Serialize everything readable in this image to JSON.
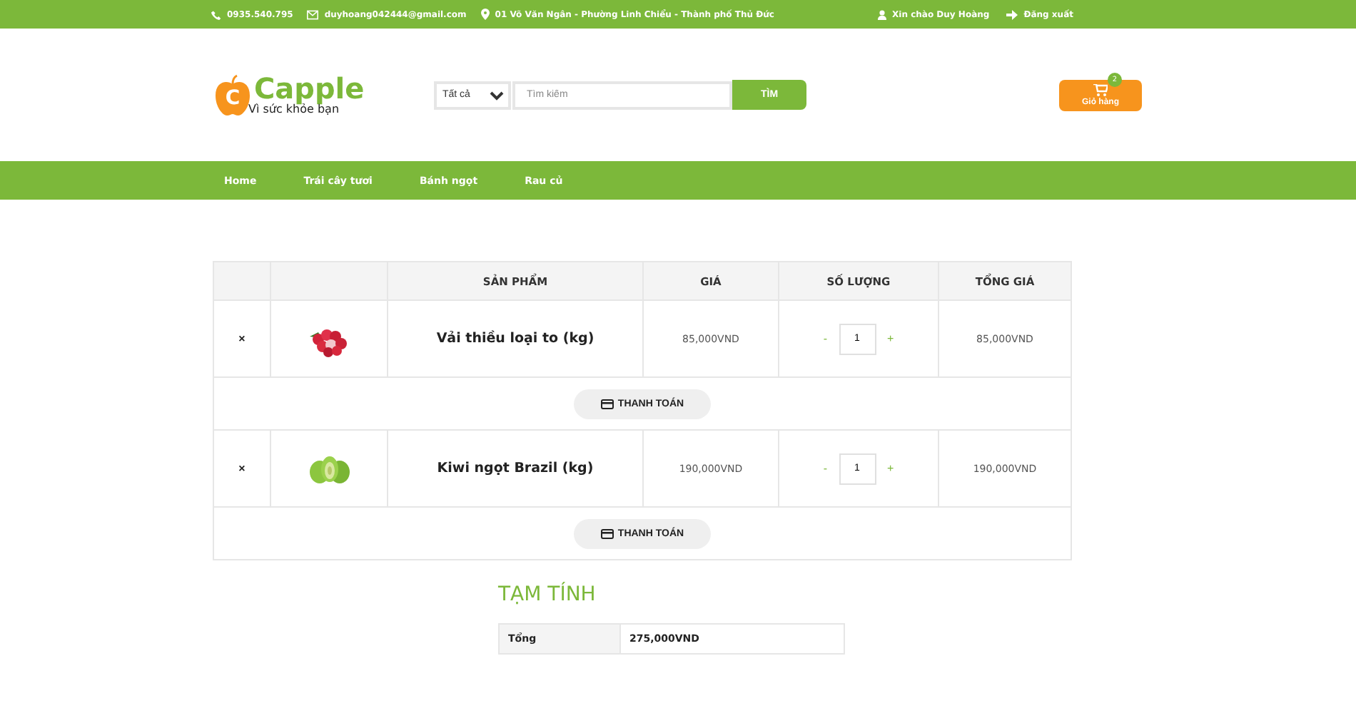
{
  "top_bar": {
    "phone": "0935.540.795",
    "email": "duyhoang042444@gmail.com",
    "address": "01 Võ Văn Ngân - Phường Linh Chiểu - Thành phố Thủ Đức",
    "greeting": "Xin chào Duy Hoàng",
    "logout": "Đăng xuất"
  },
  "header": {
    "logo_letter": "C",
    "logo_name": "Capple",
    "tagline": "Vì sức khỏe bạn",
    "category_select": "Tất cả",
    "search": {
      "placeholder": "Tìm kiếm"
    },
    "search_button": "TÌM",
    "cart": {
      "label": "Giỏ hàng",
      "count": "2"
    }
  },
  "nav": [
    {
      "label": "Home"
    },
    {
      "label": "Trái cây tươi"
    },
    {
      "label": "Bánh ngọt"
    },
    {
      "label": "Rau củ"
    }
  ],
  "cart_table": {
    "columns": [
      "SẢN PHẨM",
      "GIÁ",
      "SỐ LƯỢNG",
      "TỔNG GIÁ"
    ],
    "rows": [
      {
        "remove": "×",
        "name": "Vải thiều loại to (kg)",
        "price": "85,000VND",
        "minus": "-",
        "quantity": "1",
        "plus": "+",
        "total": "85,000VND",
        "checkout": "THANH TOÁN"
      },
      {
        "remove": "×",
        "name": "Kiwi ngọt Brazil (kg)",
        "price": "190,000VND",
        "minus": "-",
        "quantity": "1",
        "plus": "+",
        "total": "190,000VND",
        "checkout": "THANH TOÁN"
      }
    ]
  },
  "subtotal": {
    "title": "TẠM TÍNH",
    "label": "Tổng",
    "value": "275,000VND"
  }
}
